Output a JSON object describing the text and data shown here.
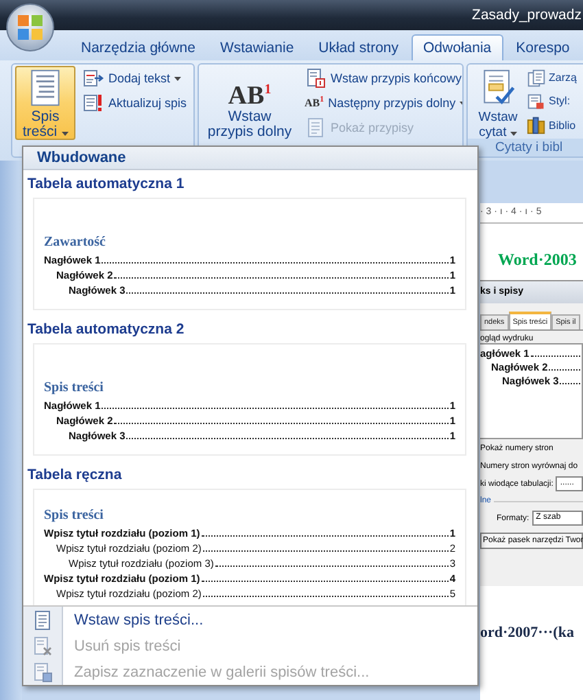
{
  "window": {
    "title": "Zasady_prowadz"
  },
  "tabs": [
    {
      "label": "Narzędzia główne",
      "selected": false
    },
    {
      "label": "Wstawianie",
      "selected": false
    },
    {
      "label": "Układ strony",
      "selected": false
    },
    {
      "label": "Odwołania",
      "selected": true
    },
    {
      "label": "Korespo",
      "selected": false
    }
  ],
  "ribbon": {
    "groups": [
      {
        "items": [
          {
            "kind": "large",
            "label": "Spis treści",
            "dropdown": true,
            "pressed": true
          },
          {
            "kind": "small",
            "label": "Dodaj tekst",
            "dropdown": true,
            "disabled": false
          },
          {
            "kind": "small",
            "label": "Aktualizuj spis",
            "dropdown": false,
            "disabled": false
          }
        ]
      },
      {
        "items": [
          {
            "kind": "large",
            "glyph": "AB$^{1}$",
            "label": "Wstaw przypis dolny",
            "dropdown": false,
            "pressed": false
          },
          {
            "kind": "small",
            "label": "Wstaw przypis końcowy",
            "dropdown": false,
            "disabled": false
          },
          {
            "kind": "small",
            "glyph": "AB$^{1}$",
            "label": "Następny przypis dolny",
            "dropdown": true,
            "disabled": false
          },
          {
            "kind": "small",
            "label": "Pokaż przypisy",
            "dropdown": false,
            "disabled": true
          }
        ]
      },
      {
        "label": "Cytaty i bibl",
        "items": [
          {
            "kind": "large",
            "label": "Wstaw cytat",
            "dropdown": true,
            "pressed": false
          },
          {
            "kind": "small",
            "label": "Zarzą",
            "dropdown": false,
            "disabled": false
          },
          {
            "kind": "small",
            "label": "Styl:",
            "dropdown": false,
            "disabled": false
          },
          {
            "kind": "small",
            "label": "Biblio",
            "dropdown": false,
            "disabled": false
          }
        ]
      }
    ]
  },
  "toc_menu": {
    "section": "Wbudowane",
    "gallery": [
      {
        "title": "Tabela automatyczna 1",
        "heading": "Zawartość",
        "lines": [
          {
            "text": "Nagłówek 1",
            "page": "1",
            "children": [
              {
                "text": "Nagłówek 2",
                "page": "1",
                "children": [
                  {
                    "text": "Nagłówek 3",
                    "page": "1"
                  }
                ]
              }
            ]
          }
        ]
      },
      {
        "title": "Tabela automatyczna 2",
        "heading": "Spis treści",
        "lines": [
          {
            "text": "Nagłówek 1",
            "page": "1",
            "children": [
              {
                "text": "Nagłówek 2",
                "page": "1",
                "children": [
                  {
                    "text": "Nagłówek 3",
                    "page": "1"
                  }
                ]
              }
            ]
          }
        ]
      },
      {
        "title": "Tabela ręczna",
        "heading": "Spis treści",
        "lines": [
          {
            "text": "Wpisz tytuł rozdziału (poziom 1)",
            "page": "1",
            "children": [
              {
                "text": "Wpisz tytuł rozdziału (poziom 2)",
                "page": "2",
                "children": [
                  {
                    "text": "Wpisz tytuł rozdziału (poziom 3)",
                    "page": "3"
                  }
                ]
              }
            ]
          },
          {
            "text": "Wpisz tytuł rozdziału (poziom 1)",
            "page": "4",
            "children": [
              {
                "text": "Wpisz tytuł rozdziału (poziom 2)",
                "page": "5"
              }
            ]
          }
        ]
      }
    ],
    "commands": [
      {
        "label": "Wstaw spis treści...",
        "disabled": false
      },
      {
        "label": "Usuń spis treści",
        "disabled": true
      },
      {
        "label": "Zapisz zaznaczenie w galerii spisów treści...",
        "disabled": true
      }
    ]
  },
  "document": {
    "ruler": "· 3 · ı · 4 · ı · 5",
    "heading": "Word·2003",
    "dialog": {
      "title": "ks i spisy",
      "tabs": [
        {
          "label": "ndeks",
          "selected": false
        },
        {
          "label": "Spis treści",
          "selected": true
        },
        {
          "label": "Spis il",
          "selected": false
        }
      ],
      "preview_label": "ogląd wydruku",
      "preview": [
        {
          "text": "agłówek 1",
          "children": [
            {
              "text": "Nagłówek 2",
              "children": [
                {
                  "text": "Nagłówek 3"
                }
              ]
            }
          ]
        }
      ],
      "options": [
        "Pokaż numery stron",
        "Numery stron wyrównaj do"
      ],
      "leader_label": "ki wiodące tabulacji:",
      "leader_value": "......",
      "section": "lne",
      "formats_label": "Formaty:",
      "formats_value": "Z szab",
      "button": "Pokaż pasek narzędzi Twor"
    },
    "heading_2": "ord·2007···(ka"
  }
}
